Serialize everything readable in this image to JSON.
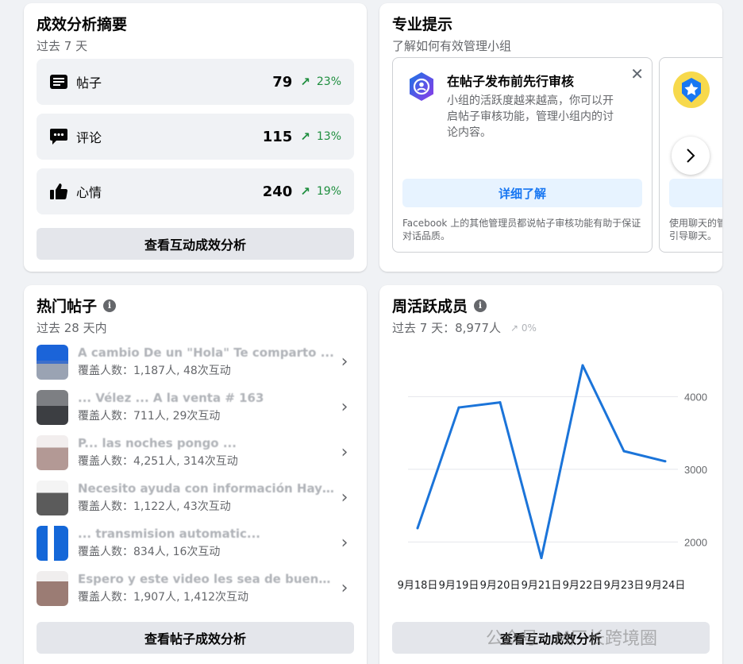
{
  "summary": {
    "title": "成效分析摘要",
    "subtitle": "过去 7 天",
    "stats": [
      {
        "label": "帖子",
        "value": "79",
        "change": "23%"
      },
      {
        "label": "评论",
        "value": "115",
        "change": "13%"
      },
      {
        "label": "心情",
        "value": "240",
        "change": "19%"
      }
    ],
    "button": "查看互动成效分析"
  },
  "tips": {
    "title": "专业提示",
    "subtitle": "了解如何有效管理小组",
    "card1": {
      "title": "在帖子发布前先行审核",
      "body": "小组的活跃度越来越高，你可以开启帖子审核功能，管理小组内的讨论内容。",
      "button": "详细了解",
      "footer": "Facebook 上的其他管理员都说帖子审核功能有助于保证对话品质。"
    },
    "card2": {
      "footer": "使用聊天的管引导聊天。"
    }
  },
  "top_posts": {
    "title": "热门帖子",
    "subtitle": "过去 28 天内",
    "items": [
      {
        "title": "A cambio De un \"Hola\" Te comparto ...",
        "meta": "覆盖人数：1,187人, 48次互动"
      },
      {
        "title": "... Vélez ... A la venta # 163",
        "meta": "覆盖人数：711人, 29次互动"
      },
      {
        "title": "P... las noches pongo ...",
        "meta": "覆盖人数：4,251人, 314次互动"
      },
      {
        "title": "Necesito ayuda con información Hay u...",
        "meta": "覆盖人数：1,122人, 43次互动"
      },
      {
        "title": "... transmision automatic...",
        "meta": "覆盖人数：834人, 16次互动"
      },
      {
        "title": "Espero y este video les sea de buena m...",
        "meta": "覆盖人数：1,907人, 1,412次互动"
      }
    ],
    "button": "查看帖子成效分析"
  },
  "weekly_active": {
    "title": "周活跃成员",
    "subtitle": "过去 7 天：8,977人",
    "change": "0%",
    "button": "查看互动成效分析"
  },
  "chart_data": {
    "type": "line",
    "categories": [
      "9月18日",
      "9月19日",
      "9月20日",
      "9月21日",
      "9月22日",
      "9月23日",
      "9月24日"
    ],
    "values": [
      2190,
      3850,
      3920,
      1780,
      4430,
      3250,
      3110
    ],
    "yticks": [
      2000,
      3000,
      4000
    ],
    "ylim": [
      1600,
      4550
    ],
    "color": "#1b74d9",
    "grid": true
  },
  "watermark": "公众号 · M厂长跨境圈"
}
